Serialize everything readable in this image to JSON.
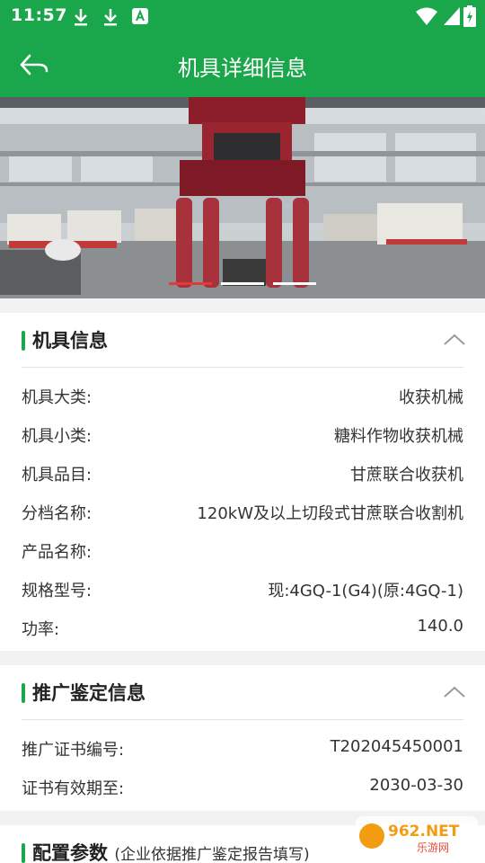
{
  "status": {
    "time": "11:57"
  },
  "header": {
    "title": "机具详细信息",
    "back_icon": "back-arrow-icon"
  },
  "banner": {
    "slides": 3,
    "active_slide": 1
  },
  "machine_info": {
    "title": "机具信息",
    "rows": [
      {
        "label": "机具大类:",
        "value": "收获机械"
      },
      {
        "label": "机具小类:",
        "value": "糖料作物收获机械"
      },
      {
        "label": "机具品目:",
        "value": "甘蔗联合收获机"
      },
      {
        "label": "分档名称:",
        "value": "120kW及以上切段式甘蔗联合收割机"
      },
      {
        "label": "产品名称:",
        "value": ""
      },
      {
        "label": "规格型号:",
        "value": "现:4GQ-1(G4)(原:4GQ-1)"
      },
      {
        "label": "功率:",
        "value": "140.0"
      }
    ]
  },
  "promotion_info": {
    "title": "推广鉴定信息",
    "rows": [
      {
        "label": "推广证书编号:",
        "value": "T202045450001"
      },
      {
        "label": "证书有效期至:",
        "value": "2030-03-30"
      }
    ]
  },
  "config_params": {
    "title": "配置参数",
    "subtitle": "(企业依据推广鉴定报告填写)"
  },
  "watermark": {
    "text_main": "962.NET",
    "text_sub": "乐游网"
  },
  "colors": {
    "primary": "#1aa64a",
    "indicator_active": "#e03a3a"
  }
}
